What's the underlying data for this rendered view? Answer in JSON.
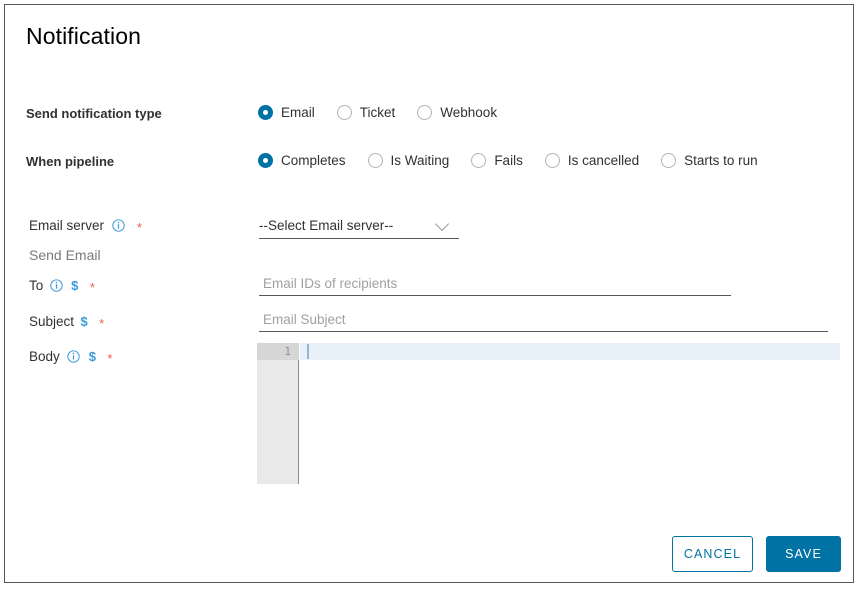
{
  "dialog": {
    "title": "Notification"
  },
  "fields": {
    "notification_type": {
      "label": "Send notification type",
      "options": [
        {
          "label": "Email",
          "selected": true
        },
        {
          "label": "Ticket",
          "selected": false
        },
        {
          "label": "Webhook",
          "selected": false
        }
      ]
    },
    "when_pipeline": {
      "label": "When pipeline",
      "options": [
        {
          "label": "Completes",
          "selected": true
        },
        {
          "label": "Is Waiting",
          "selected": false
        },
        {
          "label": "Fails",
          "selected": false
        },
        {
          "label": "Is cancelled",
          "selected": false
        },
        {
          "label": "Starts to run",
          "selected": false
        }
      ]
    },
    "email_server": {
      "label": "Email server",
      "info_icon": "info-circle-icon",
      "required_marker": "*",
      "value": "--Select Email server--",
      "caret_icon": "chevron-down-icon"
    },
    "section_send_email": {
      "label": "Send Email"
    },
    "to": {
      "label": "To",
      "info_icon": "info-circle-icon",
      "var_marker": "$",
      "required_marker": "*",
      "value": "",
      "placeholder": "Email IDs of recipients"
    },
    "subject": {
      "label": "Subject",
      "var_marker": "$",
      "required_marker": "*",
      "value": "",
      "placeholder": "Email Subject"
    },
    "body": {
      "label": "Body",
      "info_icon": "info-circle-icon",
      "var_marker": "$",
      "required_marker": "*",
      "line_number": "1",
      "content": ""
    }
  },
  "footer": {
    "cancel_label": "CANCEL",
    "save_label": "SAVE"
  },
  "colors": {
    "accent": "#0072a3",
    "required": "#e8604b",
    "variable": "#3b9ad9",
    "text": "#313131",
    "muted": "#7a7a7a",
    "active_line": "#e8f0fa",
    "gutter": "#e9e9e9"
  }
}
